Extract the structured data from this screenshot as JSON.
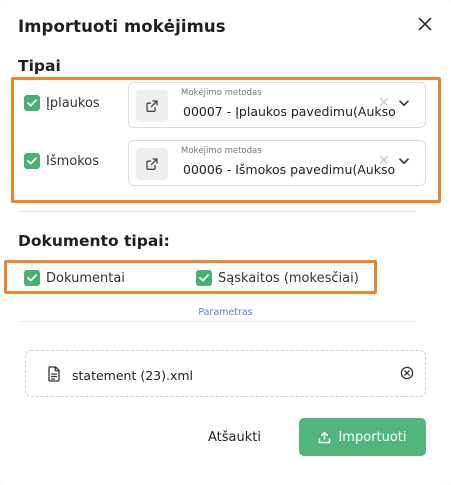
{
  "dialog": {
    "title": "Importuoti mokėjimus"
  },
  "types_section": {
    "title": "Tipai",
    "rows": [
      {
        "label": "Įplaukos",
        "checked": true,
        "method_caption": "Mokėjimo metodas",
        "method_value": "00007 - Įplaukos pavedimu(Aukso"
      },
      {
        "label": "Išmokos",
        "checked": true,
        "method_caption": "Mokėjimo metodas",
        "method_value": "00006 - Išmokos pavedimu(Aukso"
      }
    ]
  },
  "document_types": {
    "title": "Dokumento tipai:",
    "options": [
      {
        "label": "Dokumentai",
        "checked": true
      },
      {
        "label": "Sąskaitos (mokesčiai)",
        "checked": true
      }
    ]
  },
  "params_link": "Parametras",
  "file": {
    "name": "statement (23).xml"
  },
  "actions": {
    "cancel_label": "Atšaukti",
    "import_label": "Importuoti"
  },
  "colors": {
    "accent_green": "#52b57b",
    "checkbox_green": "#4caf72",
    "highlight_orange": "#ef8430",
    "link_blue": "#5a7fbf"
  }
}
